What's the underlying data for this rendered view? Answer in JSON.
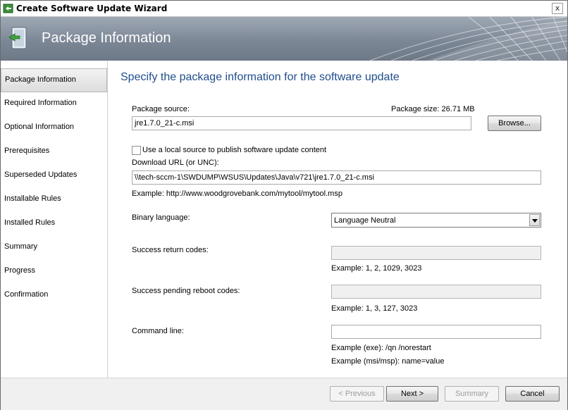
{
  "window": {
    "title": "Create Software Update Wizard",
    "close_glyph": "x"
  },
  "banner": {
    "title": "Package Information"
  },
  "nav": {
    "items": [
      {
        "label": "Package Information",
        "active": true
      },
      {
        "label": "Required Information"
      },
      {
        "label": "Optional Information"
      },
      {
        "label": "Prerequisites"
      },
      {
        "label": "Superseded Updates"
      },
      {
        "label": "Installable Rules"
      },
      {
        "label": "Installed Rules"
      },
      {
        "label": "Summary"
      },
      {
        "label": "Progress"
      },
      {
        "label": "Confirmation"
      }
    ]
  },
  "main": {
    "heading": "Specify the package information for the software update",
    "package_source": {
      "label": "Package source:",
      "size_label": "Package size: 26.71 MB",
      "value": "jre1.7.0_21-c.msi",
      "browse_label": "Browse..."
    },
    "local_source": {
      "label": "Use a local source to publish software update content",
      "checked": false
    },
    "download_url": {
      "label": "Download URL (or UNC):",
      "value": "\\\\tech-sccm-1\\SWDUMP\\WSUS\\Updates\\Java\\v721\\jre1.7.0_21-c.msi",
      "example": "Example: http://www.woodgrovebank.com/mytool/mytool.msp"
    },
    "binary_language": {
      "label": "Binary language:",
      "value": "Language Neutral"
    },
    "success_codes": {
      "label": "Success return codes:",
      "value": "",
      "example": "Example: 1, 2, 1029, 3023"
    },
    "pending_reboot_codes": {
      "label": "Success pending reboot codes:",
      "value": "",
      "example": "Example: 1, 3, 127, 3023"
    },
    "command_line": {
      "label": "Command line:",
      "value": "",
      "example_exe": "Example (exe): /qn /norestart",
      "example_msi": "Example (msi/msp): name=value"
    }
  },
  "footer": {
    "previous_label": "< Previous",
    "next_label": "Next >",
    "summary_label": "Summary",
    "cancel_label": "Cancel"
  },
  "colors": {
    "heading": "#1f4e8c",
    "banner": "#7c8796"
  }
}
